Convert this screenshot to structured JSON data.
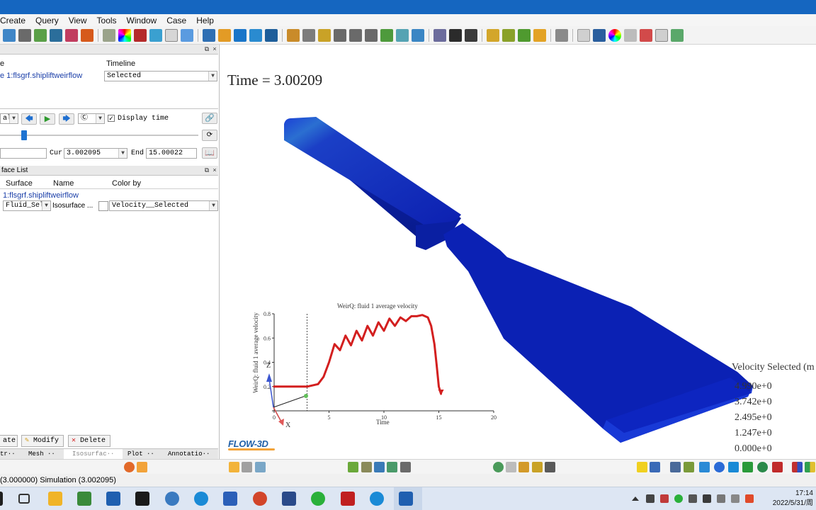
{
  "menu": [
    "Create",
    "Query",
    "View",
    "Tools",
    "Window",
    "Case",
    "Help"
  ],
  "results": {
    "col_file": "e",
    "col_timeline": "Timeline",
    "simulation": "e 1:flsgrf.shipliftweirflow",
    "timeline_value": "Selected"
  },
  "animation": {
    "mode": "al",
    "display_time_label": "Display time",
    "display_time_checked": true,
    "start_value": "",
    "cur_label": "Cur",
    "cur_value": "3.002095",
    "end_label": "End",
    "end_value": "15.00022",
    "slider_fraction": 0.11
  },
  "surface_list": {
    "title": "face List",
    "col_surface": "Surface",
    "col_name": "Name",
    "col_color": "Color by",
    "row_header": "1:flsgrf.shipliftweirflow",
    "surface": "Fluid_Sele",
    "name": "Isosurface ...",
    "color_by": "Velocity__Selected"
  },
  "buttons": {
    "create": "ate",
    "modify": "Modify",
    "delete": "Delete"
  },
  "tabs": [
    "tr··",
    "Mesh ··",
    "Isosurfac··",
    "Plot ··",
    "Annotatio··"
  ],
  "viewport": {
    "time_label": "Time = 3.00209",
    "axis_z": "Z",
    "axis_x": "X",
    "logo": "FLOW-3D"
  },
  "legend": {
    "title": "Velocity Selected (m",
    "values": [
      "4.990e+0",
      "3.742e+0",
      "2.495e+0",
      "1.247e+0",
      "0.000e+0"
    ]
  },
  "chart_data": {
    "type": "line",
    "title": "WeirQ: fluid 1 average velocity",
    "xlabel": "Time",
    "ylabel": "WeirQ: fluid 1 average velocity",
    "xlim": [
      0,
      20
    ],
    "ylim": [
      0,
      0.8
    ],
    "x_ticks": [
      "0",
      "5",
      "10",
      "15",
      "20"
    ],
    "y_ticks": [
      "0.2",
      "0.4",
      "0.6",
      "0.8"
    ],
    "current_time": 3.0,
    "series": [
      {
        "color": "#d31f1f",
        "x": [
          0,
          1,
          2,
          3,
          4,
          4.5,
          5,
          5.5,
          6,
          6.5,
          7,
          7.5,
          8,
          8.5,
          9,
          9.5,
          10,
          10.5,
          11,
          11.5,
          12,
          12.5,
          13,
          13.5,
          14,
          14.3,
          14.6,
          14.8,
          15.0,
          15.2
        ],
        "y": [
          0.2,
          0.2,
          0.2,
          0.2,
          0.22,
          0.28,
          0.4,
          0.55,
          0.5,
          0.62,
          0.54,
          0.66,
          0.58,
          0.7,
          0.62,
          0.73,
          0.66,
          0.76,
          0.7,
          0.77,
          0.74,
          0.78,
          0.78,
          0.79,
          0.77,
          0.7,
          0.55,
          0.38,
          0.2,
          0.14
        ]
      }
    ]
  },
  "status": "(3.000000) Simulation (3.002095)",
  "clock": {
    "time": "17:14",
    "date": "2022/5/31/周"
  }
}
